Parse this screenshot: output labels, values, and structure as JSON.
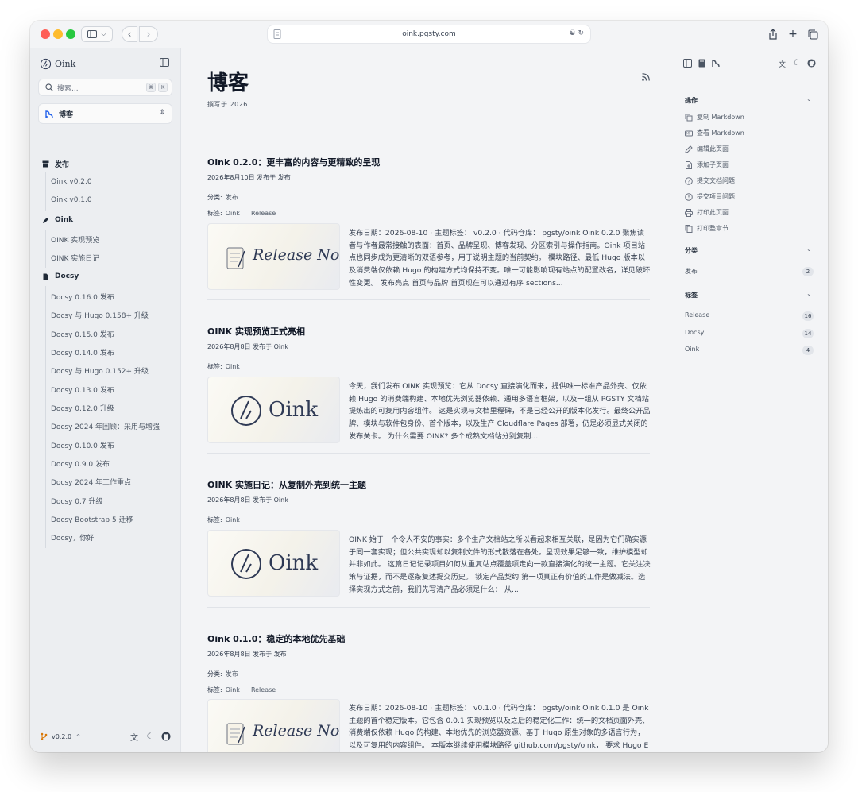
{
  "browser": {
    "url": "oink.pgsty.com"
  },
  "sidebar": {
    "brand": "Oink",
    "search_placeholder": "搜索...",
    "shortcut_key1": "⌘",
    "shortcut_key2": "K",
    "section": "博客",
    "groups": [
      {
        "label": "发布",
        "items": [
          "Oink v0.2.0",
          "Oink v0.1.0"
        ]
      },
      {
        "label": "Oink",
        "items": [
          "OINK 实现预览",
          "OINK 实施日记"
        ]
      },
      {
        "label": "Docsy",
        "items": [
          "Docsy 0.16.0 发布",
          "Docsy 与 Hugo 0.158+ 升级",
          "Docsy 0.15.0 发布",
          "Docsy 0.14.0 发布",
          "Docsy 与 Hugo 0.152+ 升级",
          "Docsy 0.13.0 发布",
          "Docsy 0.12.0 升级",
          "Docsy 2024 年回顾：采用与增强",
          "Docsy 0.10.0 发布",
          "Docsy 0.9.0 发布",
          "Docsy 2024 年工作重点",
          "Docsy 0.7 升级",
          "Docsy Bootstrap 5 迁移",
          "Docsy，你好"
        ]
      }
    ],
    "version": "v0.2.0"
  },
  "main": {
    "title": "博客",
    "subtitle": "撰写于 2026",
    "posts": [
      {
        "title": "Oink 0.2.0：更丰富的内容与更精致的呈现",
        "meta": "2026年8月10日 发布于 发布",
        "category_label": "分类:",
        "category": "发布",
        "tags_label": "标签:",
        "tags": [
          "Oink",
          "Release"
        ],
        "thumb_text": "Release Note",
        "excerpt": "发布日期：2026-08-10 · 主题标签： v0.2.0 · 代码仓库： pgsty/oink Oink 0.2.0 聚焦读者与作者最常接触的表面：首页、品牌呈现、博客发现、分区索引与操作指南。Oink 项目站点也同步成为更清晰的双语参考，用于说明主题的当前契约。 模块路径、最低 Hugo 版本以及消费端仅依赖 Hugo 的构建方式均保持不变。唯一可能影响现有站点的配置改名，详见破坏性变更。 发布亮点 首页与品牌 首页现在可以通过有序 sections..."
      },
      {
        "title": "OINK 实现预览正式亮相",
        "meta": "2026年8月8日 发布于 Oink",
        "tags_label": "标签:",
        "tags": [
          "Oink"
        ],
        "thumb_text": "Oink",
        "excerpt": "今天，我们发布 OINK 实现预览：它从 Docsy 直接演化而来，提供唯一标准产品外壳、仅依赖 Hugo 的消费端构建、本地优先浏览器依赖、通用多语言框架，以及一组从 PGSTY 文档站提炼出的可复用内容组件。 这是实现与文档里程碑，不是已经公开的版本化发行。最终公开品牌、模块与软件包身份、首个版本，以及生产 Cloudflare Pages 部署，仍是必须显式关闭的发布关卡。 为什么需要 OINK? 多个成熟文档站分别复制..."
      },
      {
        "title": "OINK 实施日记：从复制外壳到统一主题",
        "meta": "2026年8月8日 发布于 Oink",
        "tags_label": "标签:",
        "tags": [
          "Oink"
        ],
        "thumb_text": "Oink",
        "excerpt": "OINK 始于一个令人不安的事实：多个生产文档站之所以看起来相互关联，是因为它们确实源于同一套实现；但公共实现却以复制文件的形式散落在各处。呈现效果足够一致，维护模型却并非如此。 这篇日记记录项目如何从重复站点覆盖项走向一款直接演化的统一主题。它关注决策与证据，而不是逐条复述提交历史。 锁定产品契约 第一项真正有价值的工作是做减法。选择实现方式之前，我们先写清产品必须是什么： 从..."
      },
      {
        "title": "Oink 0.1.0：稳定的本地优先基础",
        "meta": "2026年8月8日 发布于 发布",
        "category_label": "分类:",
        "category": "发布",
        "tags_label": "标签:",
        "tags": [
          "Oink",
          "Release"
        ],
        "thumb_text": "Release Note",
        "excerpt": "发布日期：2026-08-10 · 主题标签： v0.1.0 · 代码仓库： pgsty/oink Oink 0.1.0 是 Oink 主题的首个稳定版本。它包含 0.0.1 实现预览以及之后的稳定化工作：统一的文档页面外壳、消费端仅依赖 Hugo 的构建、本地优先的浏览器资源、基于 Hugo 原生对象的多语言行为，以及可复用的内容组件。 本版本继续使用模块路径 github.com/pgsty/oink， 要求 Hugo Extended 0.160.1 或更高版本。消费站点在构建..."
      }
    ]
  },
  "rpanel": {
    "actions_title": "操作",
    "actions": [
      "复制 Markdown",
      "查看 Markdown",
      "编辑此页面",
      "添加子页面",
      "提交文档问题",
      "提交项目问题",
      "打印此页面",
      "打印整章节"
    ],
    "categories_title": "分类",
    "categories": [
      {
        "name": "发布",
        "count": "2"
      }
    ],
    "tags_title": "标签",
    "tags": [
      {
        "name": "Release",
        "count": "16"
      },
      {
        "name": "Docsy",
        "count": "14"
      },
      {
        "name": "Oink",
        "count": "4"
      }
    ]
  }
}
